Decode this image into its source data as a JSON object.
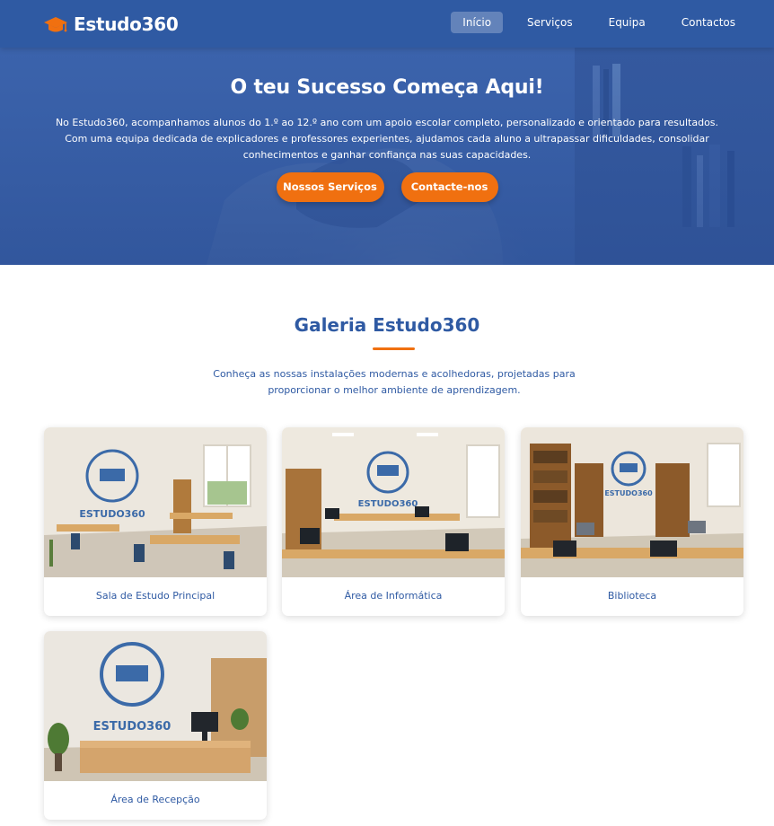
{
  "brand": {
    "name": "Estudo360",
    "icon": "graduation-cap-icon"
  },
  "nav": {
    "items": [
      {
        "label": "Início",
        "active": true
      },
      {
        "label": "Serviços",
        "active": false
      },
      {
        "label": "Equipa",
        "active": false
      },
      {
        "label": "Contactos",
        "active": false
      }
    ]
  },
  "hero": {
    "title": "O teu Sucesso Começa Aqui!",
    "line1": "No Estudo360, acompanhamos alunos do 1.º ao 12.º ano com um apoio escolar completo, personalizado e orientado para resultados.",
    "line2": "Com uma equipa dedicada de explicadores e professores experientes, ajudamos cada aluno a ultrapassar dificuldades, consolidar conhecimentos e ganhar confiança nas suas capacidades.",
    "button_services": "Nossos Serviços",
    "button_contact": "Contacte-nos"
  },
  "gallery": {
    "title": "Galeria Estudo360",
    "subtitle": "Conheça as nossas instalações modernas e acolhedoras, projetadas para proporcionar o melhor ambiente de aprendizagem.",
    "items": [
      {
        "label": "Sala de Estudo Principal",
        "wall_text": "ESTUDO360"
      },
      {
        "label": "Área de Informática",
        "wall_text": "ESTUDO360"
      },
      {
        "label": "Biblioteca",
        "wall_text": "ESTUDO360"
      },
      {
        "label": "Área de Recepção",
        "wall_text": "ESTUDO360"
      }
    ]
  },
  "colors": {
    "primary": "#2f5aa3",
    "accent": "#f07010",
    "background": "#ffffff"
  }
}
